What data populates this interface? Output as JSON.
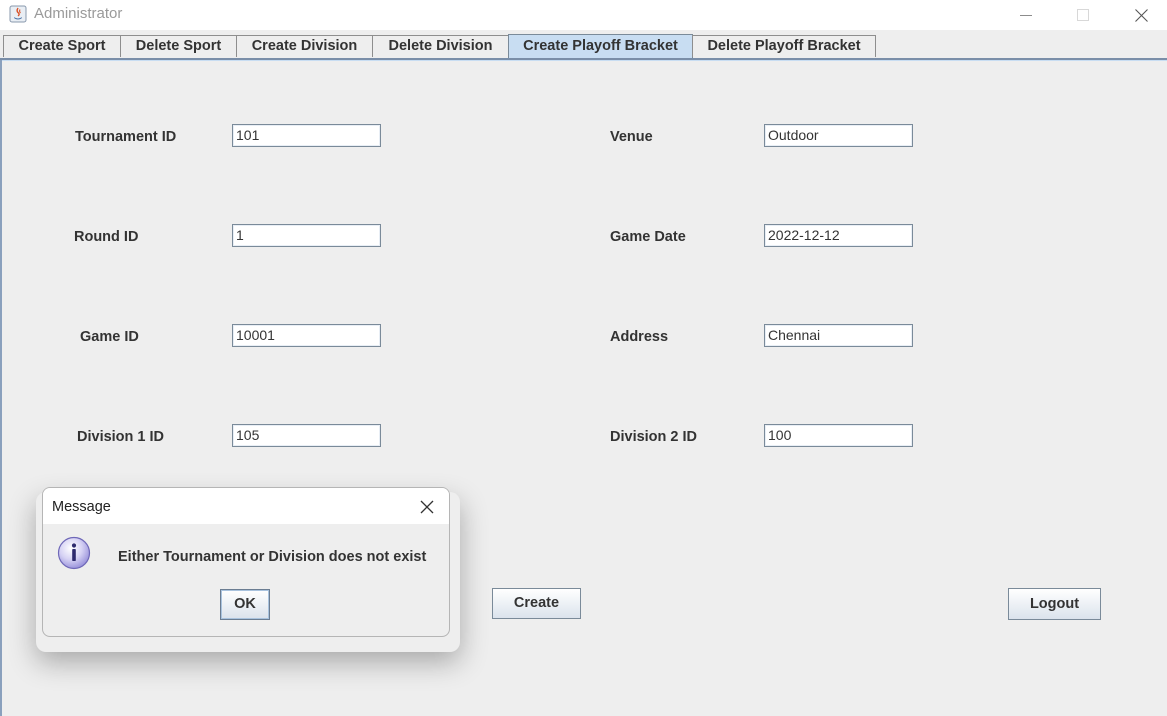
{
  "window": {
    "title": "Administrator",
    "minimize_glyph": "—",
    "maximize_glyph": "☐",
    "close_glyph": "✕"
  },
  "tabs": [
    {
      "label": "Create Sport"
    },
    {
      "label": "Delete Sport"
    },
    {
      "label": "Create Division"
    },
    {
      "label": "Delete Division"
    },
    {
      "label": "Create Playoff Bracket",
      "active": true
    },
    {
      "label": "Delete Playoff Bracket"
    }
  ],
  "form": {
    "tournament_id": {
      "label": "Tournament ID",
      "value": "101"
    },
    "round_id": {
      "label": "Round ID",
      "value": "1"
    },
    "game_id": {
      "label": "Game ID",
      "value": "10001"
    },
    "division1_id": {
      "label": "Division 1 ID",
      "value": "105"
    },
    "venue": {
      "label": "Venue",
      "value": "Outdoor"
    },
    "game_date": {
      "label": "Game Date",
      "value": "2022-12-12"
    },
    "address": {
      "label": "Address",
      "value": "Chennai"
    },
    "division2_id": {
      "label": "Division 2 ID",
      "value": "100"
    }
  },
  "buttons": {
    "create": "Create",
    "logout": "Logout"
  },
  "dialog": {
    "title": "Message",
    "message": "Either Tournament or Division does not exist",
    "ok": "OK",
    "icon": "info-icon"
  },
  "colors": {
    "active_tab": "#c8ddf2",
    "background": "#eeeeee",
    "info_icon": "#b3aee8"
  }
}
